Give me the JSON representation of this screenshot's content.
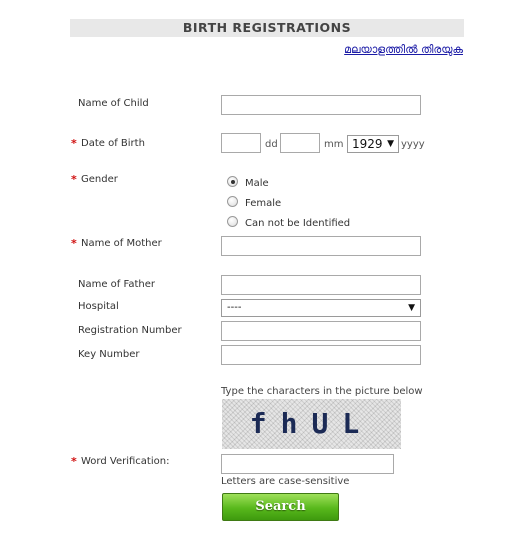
{
  "page": {
    "title": "BIRTH REGISTRATIONS",
    "language_link": "മലയാളത്തിൽ തിരയുക"
  },
  "form": {
    "name_of_child": {
      "label": "Name of Child",
      "value": ""
    },
    "date_of_birth": {
      "label": "Date of Birth",
      "required_mark": "*",
      "dd_unit": "dd",
      "mm_unit": "mm",
      "yyyy_unit": "yyyy",
      "year_selected": "1929",
      "dd_value": "",
      "mm_value": ""
    },
    "gender": {
      "label": "Gender",
      "required_mark": "*",
      "options": [
        {
          "label": "Male",
          "checked": true
        },
        {
          "label": "Female",
          "checked": false
        },
        {
          "label": "Can not be Identified",
          "checked": false
        }
      ]
    },
    "name_of_mother": {
      "label": "Name of Mother",
      "required_mark": "*",
      "value": ""
    },
    "name_of_father": {
      "label": "Name of Father",
      "value": ""
    },
    "hospital": {
      "label": "Hospital",
      "selected": "----"
    },
    "registration_number": {
      "label": "Registration Number",
      "value": ""
    },
    "key_number": {
      "label": "Key Number",
      "value": ""
    },
    "captcha": {
      "instruction": "Type the characters in the picture below",
      "image_text": "fhUL",
      "label": "Word Verification:",
      "required_mark": "*",
      "note": "Letters are case-sensitive",
      "value": ""
    },
    "search_button": "Search"
  },
  "colors": {
    "required": "#d01010",
    "link": "#1a1aa6",
    "button_green": "#58b81c",
    "title_bar": "#e8e8e8"
  },
  "icons": {
    "dropdown": "caret-down-icon"
  }
}
